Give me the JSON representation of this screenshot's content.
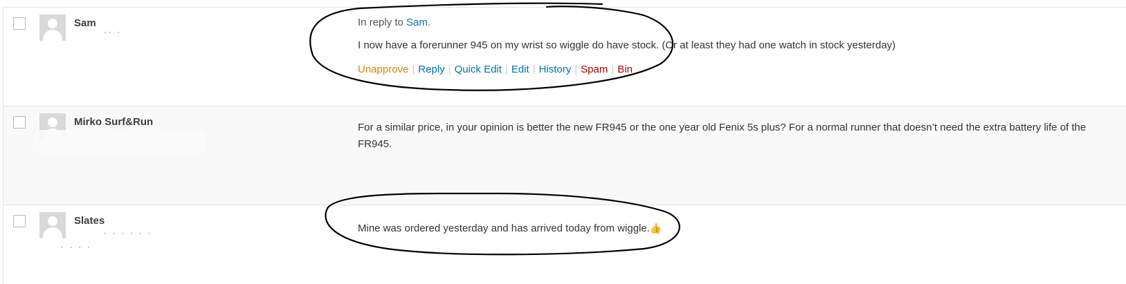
{
  "comments": [
    {
      "author": "Sam",
      "in_reply_prefix": "In reply to ",
      "in_reply_name": "Sam",
      "in_reply_suffix": ".",
      "text": "I now have a forerunner 945 on my wrist so wiggle do have stock. (Or at least they had one watch in stock yesterday)",
      "actions": {
        "unapprove": "Unapprove",
        "reply": "Reply",
        "quick_edit": "Quick Edit",
        "edit": "Edit",
        "history": "History",
        "spam": "Spam",
        "bin": "Bin"
      }
    },
    {
      "author": "Mirko Surf&Run",
      "text": "For a similar price, in your opinion is better the new FR945 or the one year old Fenix 5s plus? For a normal runner that doesn’t need the extra battery life of the FR945."
    },
    {
      "author": "Slates",
      "text": "Mine was ordered yesterday and has arrived today from wiggle.",
      "emoji": "👍"
    }
  ],
  "separator": "|",
  "colors": {
    "link": "#0073aa",
    "unapprove": "#d98500",
    "danger": "#aa0000",
    "alt_row": "#f9f9f9"
  }
}
